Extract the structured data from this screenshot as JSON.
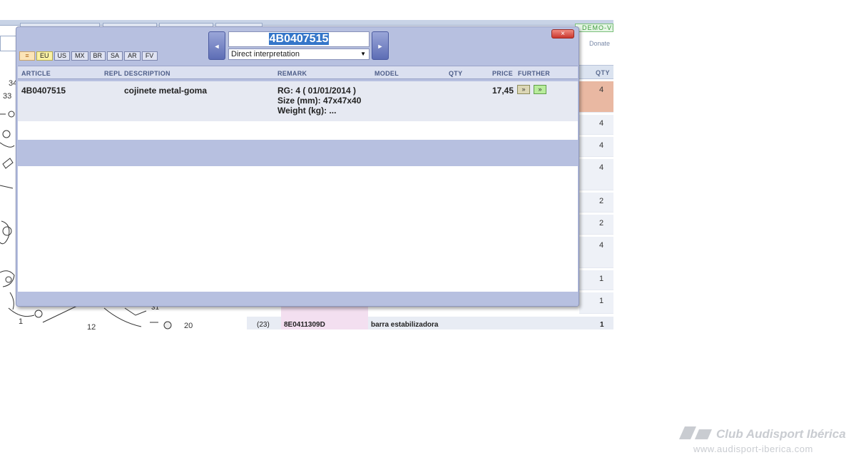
{
  "background": {
    "demo_badge": "DEMO-VI",
    "donate_link": "Donate",
    "qty_header": "QTY",
    "qty_values": [
      "4",
      "4",
      "4",
      "4",
      "2",
      "2",
      "4",
      "1",
      "1"
    ],
    "diagram_labels": [
      "34",
      "33",
      "31",
      "12",
      "20",
      "1"
    ],
    "bottom_row": {
      "position": "(23)",
      "part": "8E0411309D",
      "description": "barra estabilizadora",
      "qty": "1"
    }
  },
  "popup": {
    "close_label": "×",
    "search_value": "4B0407515",
    "mode_selected": "Direct interpretation",
    "nav_prev_label": "◄",
    "nav_next_label": "►",
    "regions": [
      "≡",
      "EU",
      "US",
      "MX",
      "BR",
      "SA",
      "AR",
      "FV"
    ],
    "columns": {
      "article": "ARTICLE",
      "repl": "REPL",
      "description": "DESCRIPTION",
      "remark": "REMARK",
      "model": "MODEL",
      "qty": "QTY",
      "price": "PRICE",
      "further": "FURTHER"
    },
    "rows": [
      {
        "article": "4B0407515",
        "description": "cojinete metal-goma",
        "remark": [
          "RG: 4 ( 01/01/2014 )",
          "Size (mm): 47x47x40",
          "Weight (kg): ..."
        ],
        "price": "17,45",
        "further_1": "»",
        "further_2": "»"
      }
    ]
  },
  "watermark": {
    "title": "Club Audisport Ibérica",
    "url": "www.audisport-iberica.com"
  },
  "colors": {
    "popup_bg": "#b7c0e0",
    "header_text": "#4d5d88",
    "highlight_row": "#e9b8a2",
    "close_red": "#c9362d"
  }
}
